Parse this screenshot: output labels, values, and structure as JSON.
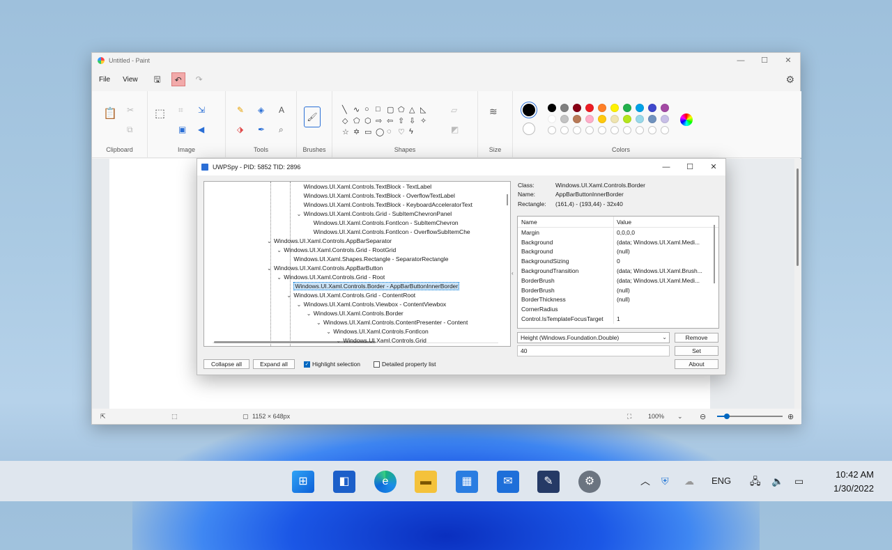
{
  "paint": {
    "title": "Untitled - Paint",
    "menu": [
      "File",
      "View"
    ],
    "groups": [
      "Clipboard",
      "Image",
      "Tools",
      "Brushes",
      "Shapes",
      "Size",
      "Colors"
    ],
    "palette": [
      "#000000",
      "#7f7f7f",
      "#880015",
      "#ed1c24",
      "#ff7f27",
      "#fff200",
      "#22b14c",
      "#00a2e8",
      "#3f48cc",
      "#a349a4",
      "#ffffff",
      "#c3c3c3",
      "#b97a57",
      "#ffaec9",
      "#ffc90e",
      "#efe4b0",
      "#b5e61d",
      "#99d9ea",
      "#7092be",
      "#c8bfe7"
    ],
    "status": {
      "size": "1152 × 648px",
      "zoom": "100%",
      "zoom_level": 0.15
    }
  },
  "spy": {
    "title": "UWPSpy - PID: 5852 TID: 2896",
    "tree": [
      {
        "d": 5,
        "tw": "",
        "t": "Windows.UI.Xaml.Controls.TextBlock - TextLabel"
      },
      {
        "d": 5,
        "tw": "",
        "t": "Windows.UI.Xaml.Controls.TextBlock - OverflowTextLabel"
      },
      {
        "d": 5,
        "tw": "",
        "t": "Windows.UI.Xaml.Controls.TextBlock - KeyboardAcceleratorText"
      },
      {
        "d": 5,
        "tw": "⌄",
        "t": "Windows.UI.Xaml.Controls.Grid - SubItemChevronPanel"
      },
      {
        "d": 6,
        "tw": "",
        "t": "Windows.UI.Xaml.Controls.FontIcon - SubItemChevron"
      },
      {
        "d": 6,
        "tw": "",
        "t": "Windows.UI.Xaml.Controls.FontIcon - OverflowSubItemChe"
      },
      {
        "d": 2,
        "tw": "⌄",
        "t": "Windows.UI.Xaml.Controls.AppBarSeparator"
      },
      {
        "d": 3,
        "tw": "⌄",
        "t": "Windows.UI.Xaml.Controls.Grid - RootGrid"
      },
      {
        "d": 4,
        "tw": "",
        "t": "Windows.UI.Xaml.Shapes.Rectangle - SeparatorRectangle"
      },
      {
        "d": 2,
        "tw": "⌄",
        "t": "Windows.UI.Xaml.Controls.AppBarButton"
      },
      {
        "d": 3,
        "tw": "⌄",
        "t": "Windows.UI.Xaml.Controls.Grid - Root"
      },
      {
        "d": 4,
        "tw": "",
        "t": "Windows.UI.Xaml.Controls.Border - AppBarButtonInnerBorder",
        "sel": true
      },
      {
        "d": 4,
        "tw": "⌄",
        "t": "Windows.UI.Xaml.Controls.Grid - ContentRoot"
      },
      {
        "d": 5,
        "tw": "⌄",
        "t": "Windows.UI.Xaml.Controls.Viewbox - ContentViewbox"
      },
      {
        "d": 6,
        "tw": "⌄",
        "t": "Windows.UI.Xaml.Controls.Border"
      },
      {
        "d": 7,
        "tw": "⌄",
        "t": "Windows.UI.Xaml.Controls.ContentPresenter - Content"
      },
      {
        "d": 8,
        "tw": "⌄",
        "t": "Windows.UI.Xaml.Controls.FontIcon"
      },
      {
        "d": 9,
        "tw": "⌄",
        "t": "Windows.UI.Xaml.Controls.Grid"
      }
    ],
    "info": {
      "class_label": "Class:",
      "class_value": "Windows.UI.Xaml.Controls.Border",
      "name_label": "Name:",
      "name_value": "AppBarButtonInnerBorder",
      "rect_label": "Rectangle:",
      "rect_value": "(161,4) - (193,44)  -  32x40"
    },
    "props_header": {
      "name": "Name",
      "value": "Value"
    },
    "props": [
      {
        "n": "Margin",
        "v": "0,0,0,0"
      },
      {
        "n": "Background",
        "v": "(data; Windows.UI.Xaml.Medi..."
      },
      {
        "n": "Background",
        "v": "(null)"
      },
      {
        "n": "BackgroundSizing",
        "v": "0"
      },
      {
        "n": "BackgroundTransition",
        "v": "(data; Windows.UI.Xaml.Brush..."
      },
      {
        "n": "BorderBrush",
        "v": "(data; Windows.UI.Xaml.Medi..."
      },
      {
        "n": "BorderBrush",
        "v": "(null)"
      },
      {
        "n": "BorderThickness",
        "v": "(null)"
      },
      {
        "n": "CornerRadius",
        "v": ""
      },
      {
        "n": "Control.IsTemplateFocusTarget",
        "v": "1"
      }
    ],
    "property_select": "Height (Windows.Foundation.Double)",
    "value_input": "40",
    "buttons": {
      "remove": "Remove",
      "set": "Set",
      "about": "About",
      "collapse": "Collapse all",
      "expand": "Expand all"
    },
    "checks": {
      "highlight": "Highlight selection",
      "detailed": "Detailed property list"
    }
  },
  "taskbar": {
    "lang": "ENG",
    "time": "10:42 AM",
    "date": "1/30/2022"
  }
}
